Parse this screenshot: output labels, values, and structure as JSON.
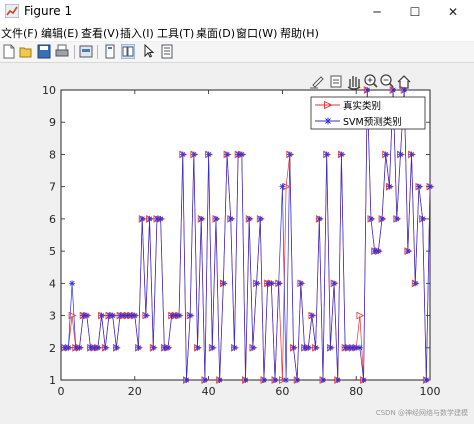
{
  "window": {
    "title": "Figure 1",
    "minimize": "─",
    "maximize": "☐",
    "close": "✕"
  },
  "menu": [
    "文件(F)",
    "编辑(E)",
    "查看(V)",
    "插入(I)",
    "工具(T)",
    "桌面(D)",
    "窗口(W)",
    "帮助(H)"
  ],
  "toolbar": [
    "new-file-icon",
    "open-file-icon",
    "save-icon",
    "print-icon",
    "link-icon",
    "panel-icon",
    "pointer-icon",
    "property-icon"
  ],
  "axes_toolbar": [
    "brush-icon",
    "data-tip-icon",
    "pan-icon",
    "zoom-in-icon",
    "zoom-out-icon",
    "home-icon"
  ],
  "watermark": "CSDN @神经网络与数学建模",
  "colors": {
    "true_series": "#e8313b",
    "pred_series": "#2f2fd8"
  },
  "chart_data": {
    "type": "line",
    "title": "",
    "xlabel": "",
    "ylabel": "",
    "xlim": [
      0,
      100
    ],
    "ylim": [
      1,
      10
    ],
    "xticks": [
      "0",
      "20",
      "40",
      "60",
      "80",
      "100"
    ],
    "yticks": [
      "1",
      "2",
      "3",
      "4",
      "5",
      "6",
      "7",
      "8",
      "9",
      "10"
    ],
    "grid": false,
    "legend_position": "top-right",
    "x": [
      1,
      2,
      3,
      4,
      5,
      6,
      7,
      8,
      9,
      10,
      11,
      12,
      13,
      14,
      15,
      16,
      17,
      18,
      19,
      20,
      21,
      22,
      23,
      24,
      25,
      26,
      27,
      28,
      29,
      30,
      31,
      32,
      33,
      34,
      35,
      36,
      37,
      38,
      39,
      40,
      41,
      42,
      43,
      44,
      45,
      46,
      47,
      48,
      49,
      50,
      51,
      52,
      53,
      54,
      55,
      56,
      57,
      58,
      59,
      60,
      61,
      62,
      63,
      64,
      65,
      66,
      67,
      68,
      69,
      70,
      71,
      72,
      73,
      74,
      75,
      76,
      77,
      78,
      79,
      80,
      81,
      82,
      83,
      84,
      85,
      86,
      87,
      88,
      89,
      90,
      91,
      92,
      93,
      94,
      95,
      96,
      97,
      98,
      99,
      100
    ],
    "series": [
      {
        "name": "真实类别",
        "marker": "triangle-right",
        "values": [
          2,
          2,
          3,
          2,
          2,
          3,
          3,
          2,
          2,
          2,
          3,
          2,
          3,
          3,
          2,
          3,
          3,
          3,
          3,
          3,
          2,
          6,
          3,
          6,
          2,
          6,
          6,
          2,
          2,
          3,
          3,
          3,
          8,
          1,
          3,
          8,
          2,
          6,
          1,
          8,
          2,
          6,
          1,
          4,
          8,
          6,
          2,
          8,
          8,
          1,
          6,
          2,
          4,
          6,
          1,
          4,
          4,
          1,
          4,
          1,
          7,
          8,
          2,
          1,
          4,
          2,
          2,
          3,
          2,
          6,
          1,
          8,
          2,
          4,
          1,
          8,
          2,
          2,
          2,
          2,
          3,
          1,
          10,
          6,
          5,
          5,
          6,
          8,
          7,
          10,
          6,
          8,
          10,
          5,
          8,
          4,
          7,
          6,
          1,
          7
        ]
      },
      {
        "name": "SVM预测类别",
        "marker": "asterisk",
        "values": [
          2,
          2,
          4,
          2,
          2,
          3,
          3,
          2,
          2,
          2,
          3,
          2,
          3,
          3,
          2,
          3,
          3,
          3,
          3,
          3,
          2,
          6,
          3,
          6,
          2,
          6,
          6,
          2,
          2,
          3,
          3,
          3,
          8,
          1,
          3,
          8,
          2,
          6,
          1,
          8,
          2,
          6,
          1,
          4,
          8,
          6,
          2,
          8,
          8,
          1,
          6,
          2,
          4,
          6,
          1,
          4,
          4,
          1,
          4,
          7,
          1,
          8,
          2,
          1,
          4,
          2,
          2,
          3,
          2,
          6,
          1,
          8,
          2,
          4,
          1,
          8,
          2,
          2,
          2,
          2,
          2,
          1,
          10,
          6,
          5,
          5,
          6,
          8,
          7,
          10,
          6,
          8,
          10,
          5,
          8,
          4,
          7,
          6,
          1,
          7
        ]
      }
    ]
  }
}
